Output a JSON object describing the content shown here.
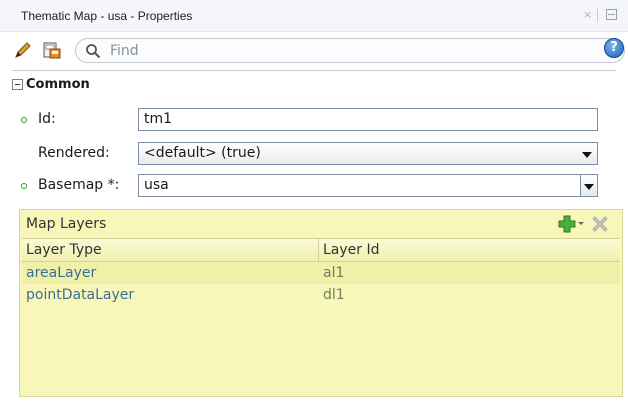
{
  "window": {
    "title": "Thematic Map - usa - Properties",
    "minimize_glyph": "×"
  },
  "toolbar": {
    "search_placeholder": "Find",
    "help_label": "?"
  },
  "section": {
    "label": "Common"
  },
  "fields": {
    "id": {
      "label": "Id:",
      "value": "tm1"
    },
    "rendered": {
      "label": "Rendered:",
      "value": "<default> (true)"
    },
    "basemap": {
      "label": "Basemap *:",
      "value": "usa"
    }
  },
  "map_layers": {
    "title": "Map Layers",
    "columns": [
      "Layer Type",
      "Layer Id"
    ],
    "rows": [
      {
        "type": "areaLayer",
        "id": "al1"
      },
      {
        "type": "pointDataLayer",
        "id": "dl1"
      }
    ]
  },
  "colors": {
    "panel_bg": "#f8f7b9",
    "required_dot": "#2e9b2e",
    "link_text": "#3a6e9a"
  },
  "icons": [
    "pencil-icon",
    "save-icon",
    "search-icon",
    "help-icon",
    "add-icon",
    "delete-icon",
    "collapse-icon"
  ]
}
